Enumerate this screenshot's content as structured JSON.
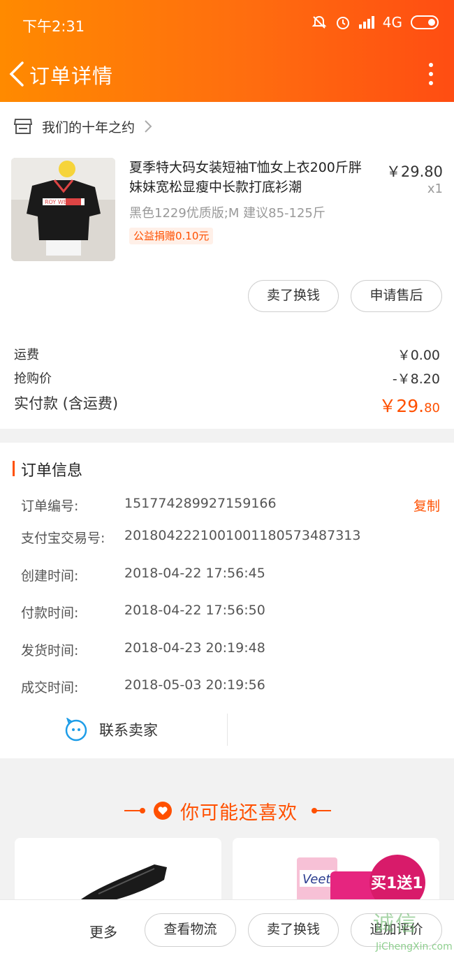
{
  "status_bar": {
    "time": "下午2:31",
    "network": "4G"
  },
  "nav": {
    "title": "订单详情"
  },
  "shop": {
    "name": "我们的十年之约"
  },
  "product": {
    "title": "夏季特大码女装短袖T恤女上衣200斤胖妹妹宽松显瘦中长款打底衫潮",
    "price": "￥29.80",
    "qty": "x1",
    "sku": "黑色1229优质版;M 建议85-125斤",
    "tag": "公益捐赠0.10元",
    "image_text": "ROY WEN"
  },
  "product_actions": {
    "sell": "卖了换钱",
    "after_sale": "申请售后"
  },
  "fees": {
    "shipping_label": "运费",
    "shipping_value": "￥0.00",
    "discount_label": "抢购价",
    "discount_value": "-￥8.20",
    "paid_label": "实付款 (含运费)",
    "paid_main": "￥29.",
    "paid_decimal": "80"
  },
  "order_info": {
    "title": "订单信息",
    "copy_label": "复制",
    "rows": [
      {
        "label": "订单编号:",
        "value": "151774289927159166"
      },
      {
        "label": "支付宝交易号:",
        "value": "2018042221001001180573487313"
      },
      {
        "label": "创建时间:",
        "value": "2018-04-22 17:56:45"
      },
      {
        "label": "付款时间:",
        "value": "2018-04-22 17:56:50"
      },
      {
        "label": "发货时间:",
        "value": "2018-04-23 20:19:48"
      },
      {
        "label": "成交时间:",
        "value": "2018-05-03 20:19:56"
      }
    ],
    "contact_label": "联系卖家"
  },
  "recommend": {
    "title": "你可能还喜欢",
    "card2_brand": "Veet",
    "card2_promo": "买1送1"
  },
  "bottom_bar": {
    "more": "更多",
    "logistics": "查看物流",
    "sell": "卖了换钱",
    "review": "追加评价"
  },
  "watermark": {
    "main": "诚信",
    "url": "JiChengXin.com"
  },
  "colors": {
    "accent": "#ff5000",
    "header_start": "#ff8a00",
    "header_end": "#ff4d12"
  }
}
